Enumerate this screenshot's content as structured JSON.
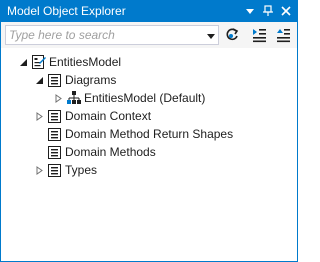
{
  "window": {
    "title": "Model Object Explorer"
  },
  "toolbar": {
    "search_placeholder": "Type here to search",
    "search_value": ""
  },
  "tree": {
    "root": {
      "label": "EntitiesModel",
      "expanded": true
    },
    "diagrams": {
      "label": "Diagrams",
      "expanded": true
    },
    "diagram_item": {
      "label": "EntitiesModel (Default)",
      "expanded": false
    },
    "domain_context": {
      "label": "Domain Context",
      "expanded": false
    },
    "return_shapes": {
      "label": "Domain Method Return Shapes"
    },
    "domain_methods": {
      "label": "Domain Methods"
    },
    "types": {
      "label": "Types",
      "expanded": false
    }
  },
  "colors": {
    "accent": "#007acc",
    "toolbar_bg": "#f5f5f5",
    "text": "#1e1e1e",
    "placeholder": "#a0a0a0"
  }
}
